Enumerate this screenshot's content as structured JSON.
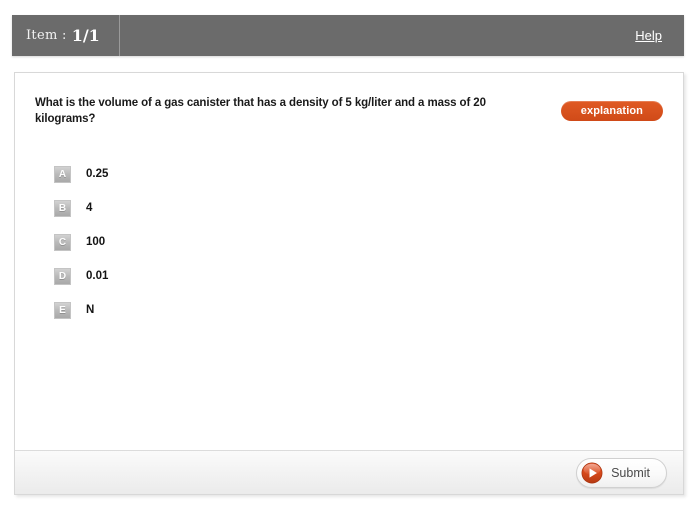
{
  "header": {
    "item_label": "Item :",
    "item_value": "1/1",
    "help_label": "Help"
  },
  "question": {
    "text": "What is the volume of a gas canister that has a density of 5 kg/liter and a mass of 20 kilograms?",
    "explanation_label": "explanation"
  },
  "options": [
    {
      "letter": "A",
      "text": "0.25"
    },
    {
      "letter": "B",
      "text": "4"
    },
    {
      "letter": "C",
      "text": "100"
    },
    {
      "letter": "D",
      "text": "0.01"
    },
    {
      "letter": "E",
      "text": "N"
    }
  ],
  "footer": {
    "submit_label": "Submit",
    "submit_icon": "play-circle-icon"
  },
  "colors": {
    "header_bg": "#6b6b6b",
    "accent_orange": "#d9521e",
    "panel_bg": "#ffffff",
    "footer_bg": "#f1f1f1"
  }
}
